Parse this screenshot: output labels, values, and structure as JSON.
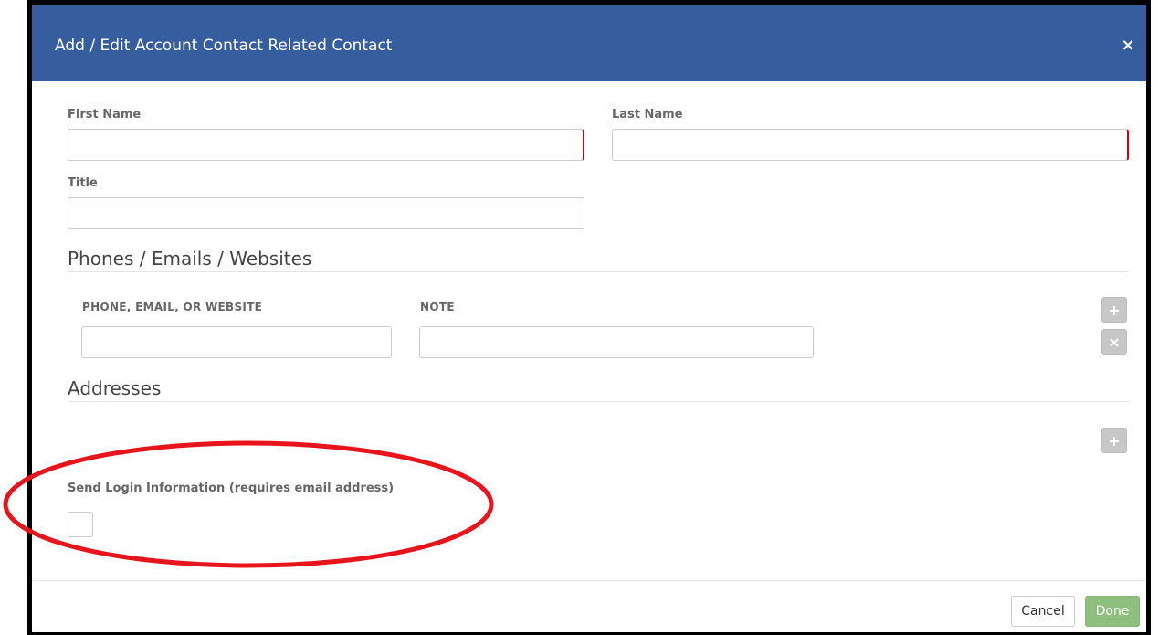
{
  "dialog": {
    "title": "Add / Edit Account Contact Related Contact",
    "close_glyph": "×"
  },
  "form": {
    "first_name": {
      "label": "First Name",
      "value": "",
      "required": true
    },
    "last_name": {
      "label": "Last Name",
      "value": "",
      "required": true
    },
    "title": {
      "label": "Title",
      "value": ""
    }
  },
  "phones_section": {
    "heading": "Phones / Emails / Websites",
    "columns": [
      "PHONE, EMAIL, OR WEBSITE",
      "NOTE"
    ],
    "rows": [
      {
        "contact": "",
        "note": ""
      }
    ],
    "add_glyph": "+",
    "remove_glyph": "×"
  },
  "addresses_section": {
    "heading": "Addresses",
    "add_glyph": "+"
  },
  "send_login": {
    "label": "Send Login Information (requires email address)",
    "checked": false
  },
  "footer": {
    "cancel_label": "Cancel",
    "done_label": "Done"
  },
  "annotation": {
    "highlight_color": "#e8141b"
  },
  "colors": {
    "header": "#365e9f",
    "required_marker": "#d0021b",
    "done_button": "#8fbf7e"
  }
}
